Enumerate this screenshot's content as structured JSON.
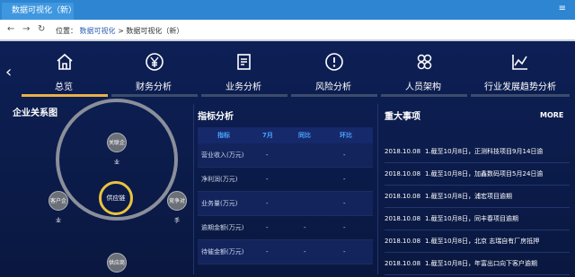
{
  "browser": {
    "tab_title": "数据可视化（新）",
    "menu_icon": "≡",
    "back_arrow": "←",
    "forward_arrow": "→",
    "refresh": "↻",
    "location_label": "位置：",
    "breadcrumb_1": "数据可视化",
    "breadcrumb_sep": ">",
    "breadcrumb_2": "数据可视化（新）"
  },
  "nav": {
    "back": "‹",
    "items": [
      {
        "label": "总览"
      },
      {
        "label": "财务分析"
      },
      {
        "label": "业务分析"
      },
      {
        "label": "风险分析"
      },
      {
        "label": "人员架构"
      },
      {
        "label": "行业发展趋势分析"
      }
    ]
  },
  "relations": {
    "title": "企业关系图",
    "center": "供应链",
    "top": "关联企业",
    "left": "客户企业",
    "right": "竞争对手",
    "bottom": "供应商"
  },
  "indicators": {
    "title": "指标分析",
    "headers": [
      "指标",
      "7月",
      "同比",
      "环比"
    ],
    "rows": [
      {
        "name": "营业收入(万元)",
        "m": "-",
        "y": "",
        "r": "-"
      },
      {
        "name": "净利润(万元)",
        "m": "-",
        "y": "",
        "r": "-"
      },
      {
        "name": "业务量(万元)",
        "m": "-",
        "y": "",
        "r": "-"
      },
      {
        "name": "逾期金额(万元)",
        "m": "-",
        "y": "-",
        "r": "-"
      },
      {
        "name": "待催金额(万元)",
        "m": "-",
        "y": "-",
        "r": "-"
      }
    ]
  },
  "events": {
    "title": "重大事项",
    "more": "MORE",
    "items": [
      {
        "date": "2018.10.08",
        "text": "1.截至10月8日，正测科技项目9月14日逾"
      },
      {
        "date": "2018.10.08",
        "text": "1.截至10月8日，加鑫数码项目5月24日逾"
      },
      {
        "date": "2018.10.08",
        "text": "1.截至10月8日，浦宏项目逾期"
      },
      {
        "date": "2018.10.08",
        "text": "1.截至10月8日，同丰春项目逾期"
      },
      {
        "date": "2018.10.08",
        "text": "1.截至10月8日，北京 志瑞自有厂房抵押"
      },
      {
        "date": "2018.10.08",
        "text": "1.截至10月8日，年富出口向下客户逾期"
      }
    ]
  },
  "colors": {
    "accent": "#e9b04a",
    "header_blue": "#4aa3ff",
    "bg": "#0b1a44"
  }
}
